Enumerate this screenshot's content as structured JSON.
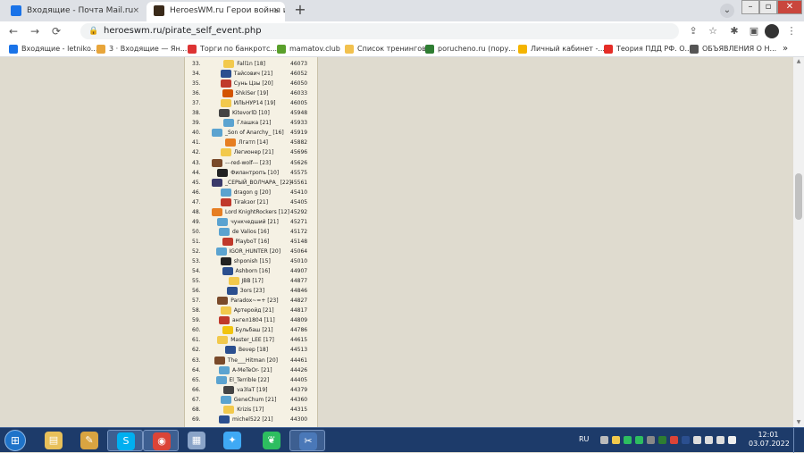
{
  "browser": {
    "tabs": [
      {
        "title": "Входящие - Почта Mail.ru",
        "favicon_color": "#1a73e8",
        "icon": "mail-icon"
      },
      {
        "title": "HeroesWM.ru Герои войны и де",
        "favicon_color": "#3a2a1a",
        "icon": "heroes-icon"
      }
    ],
    "close_symbol": "×",
    "new_tab_symbol": "+",
    "tab_search_symbol": "⌄",
    "window_controls": {
      "minimize": "–",
      "maximize": "▫",
      "close": "✕"
    },
    "nav": {
      "back": "←",
      "forward": "→",
      "reload": "⟳"
    },
    "url": "heroeswm.ru/pirate_self_event.php",
    "lock_symbol": "🔒",
    "toolbar_icons": {
      "share": "⇪",
      "star": "☆",
      "extensions": "✱",
      "sidepanel": "▣",
      "menu": "⋮"
    },
    "bookmarks": [
      {
        "label": "Входящие - letniko...",
        "color": "#1a73e8"
      },
      {
        "label": "3 · Входящие — Ян...",
        "color": "#e8a53a"
      },
      {
        "label": "Торги по банкротс...",
        "color": "#d33"
      },
      {
        "label": "mamatov.club",
        "color": "#5aa02c"
      },
      {
        "label": "Список тренингов",
        "color": "#f2c14e"
      },
      {
        "label": "poruchenо.ru (пору...",
        "color": "#2e7d32"
      },
      {
        "label": "Личный кабинет -...",
        "color": "#f4b400"
      },
      {
        "label": "Теория ПДД РФ. О...",
        "color": "#e52d27"
      },
      {
        "label": "ОБЪЯВЛЕНИЯ О Н...",
        "color": "#555"
      }
    ],
    "bookmarks_more": "»"
  },
  "leaderboard": {
    "rows": [
      {
        "rank": "33.",
        "name": "Fall1n [18]",
        "score": "46073",
        "icon_color": "#f2c94c"
      },
      {
        "rank": "34.",
        "name": "Тайсович [21]",
        "score": "46052",
        "icon_color": "#2b4f8f"
      },
      {
        "rank": "35.",
        "name": "Сунь Цзы [20]",
        "score": "46050",
        "icon_color": "#c0392b"
      },
      {
        "rank": "36.",
        "name": "ShkiSer [19]",
        "score": "46033",
        "icon_color": "#d35400"
      },
      {
        "rank": "37.",
        "name": "ИЛЬНУР14 [19]",
        "score": "46005",
        "icon_color": "#f2c94c"
      },
      {
        "rank": "38.",
        "name": "KitevorlD [10]",
        "score": "45948",
        "icon_color": "#444444"
      },
      {
        "rank": "39.",
        "name": "Глашка [21]",
        "score": "45933",
        "icon_color": "#5ba3d0"
      },
      {
        "rank": "40.",
        "name": "_Son of Anarchy_ [16]",
        "score": "45919",
        "icon_color": "#5ba3d0"
      },
      {
        "rank": "41.",
        "name": "Лгатп [14]",
        "score": "45882",
        "icon_color": "#e67e22"
      },
      {
        "rank": "42.",
        "name": "Легионер [21]",
        "score": "45696",
        "icon_color": "#f2c94c"
      },
      {
        "rank": "43.",
        "name": "---red-wolf--- [23]",
        "score": "45626",
        "icon_color": "#7a4a2a"
      },
      {
        "rank": "44.",
        "name": "Филантропъ [10]",
        "score": "45575",
        "icon_color": "#222222"
      },
      {
        "rank": "45.",
        "name": "_СЕРЫЙ_ВОЛЧАРА_ [22]",
        "score": "45561",
        "icon_color": "#3a3a6a"
      },
      {
        "rank": "46.",
        "name": "dragon g [20]",
        "score": "45410",
        "icon_color": "#5ba3d0"
      },
      {
        "rank": "47.",
        "name": "Tirakзor [21]",
        "score": "45405",
        "icon_color": "#c0392b"
      },
      {
        "rank": "48.",
        "name": "Lord KnightRockers [12]",
        "score": "45292",
        "icon_color": "#e67e22"
      },
      {
        "rank": "49.",
        "name": "чункчедший [21]",
        "score": "45271",
        "icon_color": "#5ba3d0"
      },
      {
        "rank": "50.",
        "name": "de Valios [16]",
        "score": "45172",
        "icon_color": "#5ba3d0"
      },
      {
        "rank": "51.",
        "name": "PlayboT [16]",
        "score": "45148",
        "icon_color": "#c0392b"
      },
      {
        "rank": "52.",
        "name": "IGOR_HUNTER [20]",
        "score": "45064",
        "icon_color": "#5ba3d0"
      },
      {
        "rank": "53.",
        "name": "shponish [15]",
        "score": "45010",
        "icon_color": "#222222"
      },
      {
        "rank": "54.",
        "name": "Ashborn [16]",
        "score": "44907",
        "icon_color": "#2b4f8f"
      },
      {
        "rank": "55.",
        "name": "JBB [17]",
        "score": "44877",
        "icon_color": "#f2c94c"
      },
      {
        "rank": "56.",
        "name": "Зоrs [23]",
        "score": "44846",
        "icon_color": "#2b4f8f"
      },
      {
        "rank": "57.",
        "name": "Paradox~=+ [23]",
        "score": "44827",
        "icon_color": "#7a4a2a"
      },
      {
        "rank": "58.",
        "name": "Артеройд [21]",
        "score": "44817",
        "icon_color": "#f2c94c"
      },
      {
        "rank": "59.",
        "name": "ангел1804 [11]",
        "score": "44809",
        "icon_color": "#c0392b"
      },
      {
        "rank": "60.",
        "name": "Бульбаш [21]",
        "score": "44786",
        "icon_color": "#f1c40f"
      },
      {
        "rank": "61.",
        "name": "Master_LEE [17]",
        "score": "44615",
        "icon_color": "#f2c94c"
      },
      {
        "rank": "62.",
        "name": "Bevep [18]",
        "score": "44513",
        "icon_color": "#2b4f8f"
      },
      {
        "rank": "63.",
        "name": "The___Hitman [20]",
        "score": "44461",
        "icon_color": "#7a4a2a"
      },
      {
        "rank": "64.",
        "name": "A-MeTeOr- [21]",
        "score": "44426",
        "icon_color": "#5ba3d0"
      },
      {
        "rank": "65.",
        "name": "El_Terrible [22]",
        "score": "44405",
        "icon_color": "#5ba3d0"
      },
      {
        "rank": "66.",
        "name": "va3laT [19]",
        "score": "44379",
        "icon_color": "#444444"
      },
      {
        "rank": "67.",
        "name": "GeneChum [21]",
        "score": "44360",
        "icon_color": "#5ba3d0"
      },
      {
        "rank": "68.",
        "name": "Krizis [17]",
        "score": "44315",
        "icon_color": "#f2c94c"
      },
      {
        "rank": "69.",
        "name": "michel522 [21]",
        "score": "44300",
        "icon_color": "#2b4f8f"
      }
    ]
  },
  "scrollbar": {
    "up": "▲",
    "down": "▼"
  },
  "taskbar": {
    "start_symbol": "⊞",
    "apps": [
      {
        "name": "explorer",
        "icon": "folder-icon",
        "color": "#e8c05a",
        "glyph": "▤",
        "running": false
      },
      {
        "name": "paint",
        "icon": "paint-icon",
        "color": "#d9a441",
        "glyph": "✎",
        "running": false
      },
      {
        "name": "skype",
        "icon": "skype-icon",
        "color": "#00aff0",
        "glyph": "S",
        "running": true
      },
      {
        "name": "chrome",
        "icon": "chrome-icon",
        "color": "#db4437",
        "glyph": "◉",
        "running": true
      },
      {
        "name": "calculator",
        "icon": "calculator-icon",
        "color": "#8aa4c8",
        "glyph": "▦",
        "running": false
      },
      {
        "name": "bird-app",
        "icon": "bird-icon",
        "color": "#3fa9f5",
        "glyph": "✦",
        "running": false
      },
      {
        "name": "evernote",
        "icon": "evernote-icon",
        "color": "#2dbe60",
        "glyph": "❦",
        "running": false
      },
      {
        "name": "screenshot-tool",
        "icon": "scissors-icon",
        "color": "#4a78b8",
        "glyph": "✂",
        "running": true
      }
    ],
    "language": "RU",
    "tray_colors": [
      "#bbbbbb",
      "#f2c94c",
      "#2dbe60",
      "#2dbe60",
      "#888888",
      "#2e7d32",
      "#db4437",
      "#2b4f8f",
      "#dddddd",
      "#dddddd",
      "#dddddd",
      "#eeeeee"
    ],
    "time": "12:01",
    "date": "03.07.2022"
  }
}
